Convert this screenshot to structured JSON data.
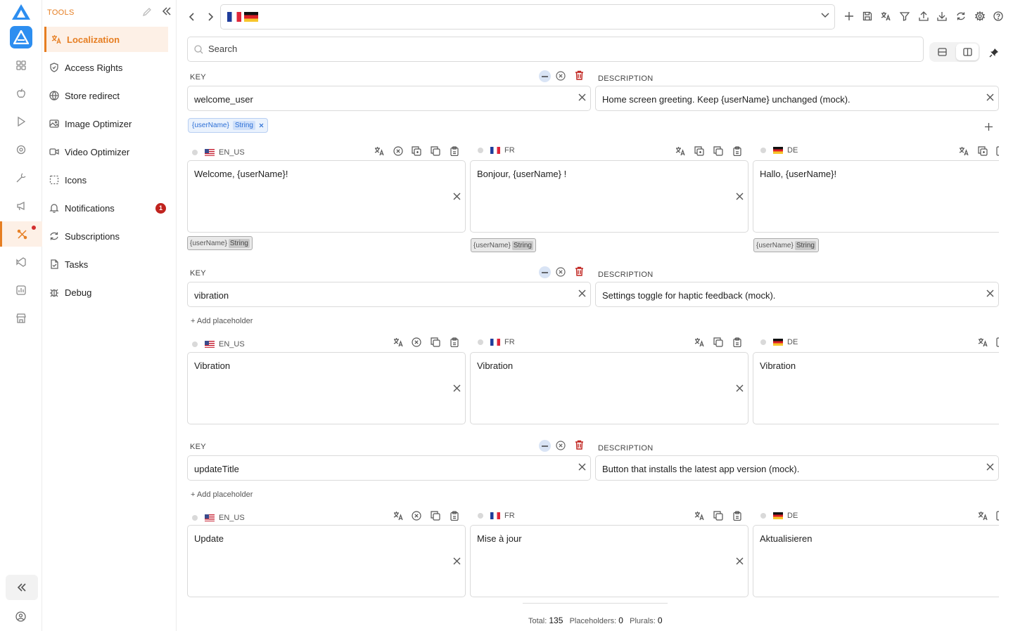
{
  "app": {
    "accent": "#e67e22",
    "brand_blue": "#2d8ef0"
  },
  "rail": {
    "icons": [
      "apps-icon",
      "apple-icon",
      "play-store-icon",
      "settings-eye-icon",
      "wrench-icon",
      "megaphone-icon",
      "tools-icon",
      "vscode-icon",
      "chart-icon",
      "store-icon"
    ],
    "active_index": 6
  },
  "sidebar": {
    "header": "TOOLS",
    "items": [
      {
        "label": "Localization",
        "icon": "translate-icon"
      },
      {
        "label": "Access Rights",
        "icon": "shield-icon"
      },
      {
        "label": "Store redirect",
        "icon": "globe-icon"
      },
      {
        "label": "Image Optimizer",
        "icon": "image-icon"
      },
      {
        "label": "Video Optimizer",
        "icon": "video-icon"
      },
      {
        "label": "Icons",
        "icon": "icons-icon"
      },
      {
        "label": "Notifications",
        "icon": "bell-icon",
        "badge": "1"
      },
      {
        "label": "Subscriptions",
        "icon": "refresh-icon"
      },
      {
        "label": "Tasks",
        "icon": "file-check-icon"
      },
      {
        "label": "Debug",
        "icon": "bug-icon"
      }
    ]
  },
  "search": {
    "placeholder": "Search"
  },
  "labels": {
    "key": "KEY",
    "description": "DESCRIPTION",
    "add_placeholder": "+ Add placeholder"
  },
  "entries": [
    {
      "key": "welcome_user",
      "description": "Home screen greeting. Keep {userName} unchanged (mock).",
      "placeholder_chip": {
        "name": "{userName}",
        "type": "String"
      },
      "translations": [
        {
          "lang": "EN_US",
          "text": "Welcome, {userName}!",
          "ph": "{userName}",
          "ph_type": "String"
        },
        {
          "lang": "FR",
          "text": "Bonjour, {userName} !",
          "ph": "{userName}",
          "ph_type": "String"
        },
        {
          "lang": "DE",
          "text": "Hallo, {userName}!",
          "ph": "{userName}",
          "ph_type": "String"
        }
      ]
    },
    {
      "key": "vibration",
      "description": "Settings toggle for haptic feedback (mock).",
      "translations": [
        {
          "lang": "EN_US",
          "text": "Vibration"
        },
        {
          "lang": "FR",
          "text": "Vibration"
        },
        {
          "lang": "DE",
          "text": "Vibration"
        }
      ]
    },
    {
      "key": "updateTitle",
      "description": "Button that installs the latest app version (mock).",
      "translations": [
        {
          "lang": "EN_US",
          "text": "Update"
        },
        {
          "lang": "FR",
          "text": "Mise à jour"
        },
        {
          "lang": "DE",
          "text": "Aktualisieren"
        }
      ]
    }
  ],
  "footer": {
    "total_label": "Total:",
    "total": "135",
    "placeholders_label": "Placeholders:",
    "placeholders": "0",
    "plurals_label": "Plurals:",
    "plurals": "0"
  }
}
